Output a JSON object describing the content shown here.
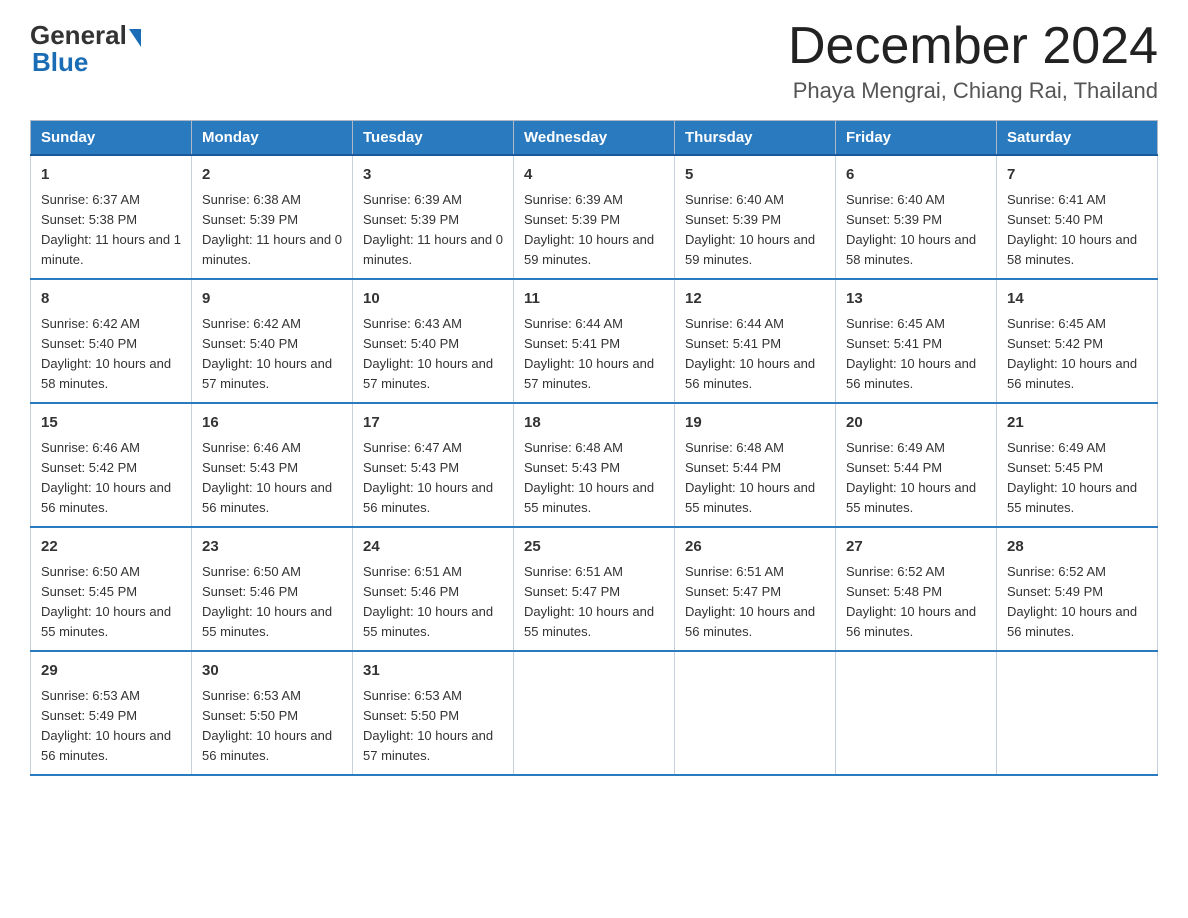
{
  "logo": {
    "general": "General",
    "blue": "Blue"
  },
  "header": {
    "month": "December 2024",
    "location": "Phaya Mengrai, Chiang Rai, Thailand"
  },
  "days_of_week": [
    "Sunday",
    "Monday",
    "Tuesday",
    "Wednesday",
    "Thursday",
    "Friday",
    "Saturday"
  ],
  "weeks": [
    [
      {
        "day": "1",
        "sunrise": "6:37 AM",
        "sunset": "5:38 PM",
        "daylight": "11 hours and 1 minute."
      },
      {
        "day": "2",
        "sunrise": "6:38 AM",
        "sunset": "5:39 PM",
        "daylight": "11 hours and 0 minutes."
      },
      {
        "day": "3",
        "sunrise": "6:39 AM",
        "sunset": "5:39 PM",
        "daylight": "11 hours and 0 minutes."
      },
      {
        "day": "4",
        "sunrise": "6:39 AM",
        "sunset": "5:39 PM",
        "daylight": "10 hours and 59 minutes."
      },
      {
        "day": "5",
        "sunrise": "6:40 AM",
        "sunset": "5:39 PM",
        "daylight": "10 hours and 59 minutes."
      },
      {
        "day": "6",
        "sunrise": "6:40 AM",
        "sunset": "5:39 PM",
        "daylight": "10 hours and 58 minutes."
      },
      {
        "day": "7",
        "sunrise": "6:41 AM",
        "sunset": "5:40 PM",
        "daylight": "10 hours and 58 minutes."
      }
    ],
    [
      {
        "day": "8",
        "sunrise": "6:42 AM",
        "sunset": "5:40 PM",
        "daylight": "10 hours and 58 minutes."
      },
      {
        "day": "9",
        "sunrise": "6:42 AM",
        "sunset": "5:40 PM",
        "daylight": "10 hours and 57 minutes."
      },
      {
        "day": "10",
        "sunrise": "6:43 AM",
        "sunset": "5:40 PM",
        "daylight": "10 hours and 57 minutes."
      },
      {
        "day": "11",
        "sunrise": "6:44 AM",
        "sunset": "5:41 PM",
        "daylight": "10 hours and 57 minutes."
      },
      {
        "day": "12",
        "sunrise": "6:44 AM",
        "sunset": "5:41 PM",
        "daylight": "10 hours and 56 minutes."
      },
      {
        "day": "13",
        "sunrise": "6:45 AM",
        "sunset": "5:41 PM",
        "daylight": "10 hours and 56 minutes."
      },
      {
        "day": "14",
        "sunrise": "6:45 AM",
        "sunset": "5:42 PM",
        "daylight": "10 hours and 56 minutes."
      }
    ],
    [
      {
        "day": "15",
        "sunrise": "6:46 AM",
        "sunset": "5:42 PM",
        "daylight": "10 hours and 56 minutes."
      },
      {
        "day": "16",
        "sunrise": "6:46 AM",
        "sunset": "5:43 PM",
        "daylight": "10 hours and 56 minutes."
      },
      {
        "day": "17",
        "sunrise": "6:47 AM",
        "sunset": "5:43 PM",
        "daylight": "10 hours and 56 minutes."
      },
      {
        "day": "18",
        "sunrise": "6:48 AM",
        "sunset": "5:43 PM",
        "daylight": "10 hours and 55 minutes."
      },
      {
        "day": "19",
        "sunrise": "6:48 AM",
        "sunset": "5:44 PM",
        "daylight": "10 hours and 55 minutes."
      },
      {
        "day": "20",
        "sunrise": "6:49 AM",
        "sunset": "5:44 PM",
        "daylight": "10 hours and 55 minutes."
      },
      {
        "day": "21",
        "sunrise": "6:49 AM",
        "sunset": "5:45 PM",
        "daylight": "10 hours and 55 minutes."
      }
    ],
    [
      {
        "day": "22",
        "sunrise": "6:50 AM",
        "sunset": "5:45 PM",
        "daylight": "10 hours and 55 minutes."
      },
      {
        "day": "23",
        "sunrise": "6:50 AM",
        "sunset": "5:46 PM",
        "daylight": "10 hours and 55 minutes."
      },
      {
        "day": "24",
        "sunrise": "6:51 AM",
        "sunset": "5:46 PM",
        "daylight": "10 hours and 55 minutes."
      },
      {
        "day": "25",
        "sunrise": "6:51 AM",
        "sunset": "5:47 PM",
        "daylight": "10 hours and 55 minutes."
      },
      {
        "day": "26",
        "sunrise": "6:51 AM",
        "sunset": "5:47 PM",
        "daylight": "10 hours and 56 minutes."
      },
      {
        "day": "27",
        "sunrise": "6:52 AM",
        "sunset": "5:48 PM",
        "daylight": "10 hours and 56 minutes."
      },
      {
        "day": "28",
        "sunrise": "6:52 AM",
        "sunset": "5:49 PM",
        "daylight": "10 hours and 56 minutes."
      }
    ],
    [
      {
        "day": "29",
        "sunrise": "6:53 AM",
        "sunset": "5:49 PM",
        "daylight": "10 hours and 56 minutes."
      },
      {
        "day": "30",
        "sunrise": "6:53 AM",
        "sunset": "5:50 PM",
        "daylight": "10 hours and 56 minutes."
      },
      {
        "day": "31",
        "sunrise": "6:53 AM",
        "sunset": "5:50 PM",
        "daylight": "10 hours and 57 minutes."
      },
      null,
      null,
      null,
      null
    ]
  ]
}
